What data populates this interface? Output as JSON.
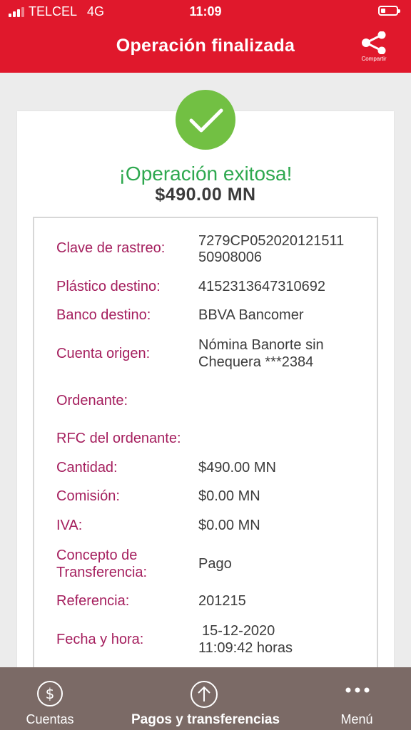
{
  "status_bar": {
    "carrier": "TELCEL",
    "network": "4G",
    "time": "11:09"
  },
  "header": {
    "title": "Operación finalizada",
    "share_label": "Compartir"
  },
  "result": {
    "message": "¡Operación exitosa!",
    "amount": "$490.00 MN"
  },
  "details": {
    "clave_label": "Clave de rastreo:",
    "clave_value_1": "7279CP052020121511",
    "clave_value_2": "50908006",
    "plastico_label": "Plástico destino:",
    "plastico_value": "4152313647310692",
    "banco_label": "Banco destino:",
    "banco_value": "BBVA Bancomer",
    "cuenta_label": "Cuenta origen:",
    "cuenta_value_1": "Nómina Banorte sin",
    "cuenta_value_2": "Chequera  ***2384",
    "ordenante_label": "Ordenante:",
    "rfc_label": "RFC del ordenante:",
    "cantidad_label": "Cantidad:",
    "cantidad_value": "$490.00 MN",
    "comision_label": "Comisión:",
    "comision_value": "$0.00 MN",
    "iva_label": "IVA:",
    "iva_value": "$0.00 MN",
    "concepto_label_1": "Concepto de",
    "concepto_label_2": "Transferencia:",
    "concepto_value": "Pago",
    "referencia_label": "Referencia:",
    "referencia_value": "201215",
    "fecha_label": "Fecha y hora:",
    "fecha_value_1": "15-12-2020",
    "fecha_value_2": "11:09:42 horas"
  },
  "bottom_nav": {
    "items": [
      {
        "label": "Cuentas",
        "icon": "dollar-circle-icon"
      },
      {
        "label": "Pagos y transferencias",
        "icon": "arrow-up-circle-icon"
      },
      {
        "label": "Menú",
        "icon": "more-dots-icon"
      }
    ]
  },
  "colors": {
    "header": "#e0182c",
    "success": "#2ea84f",
    "label": "#a51f5e",
    "nav": "#7b6a66",
    "check": "#72c043"
  }
}
